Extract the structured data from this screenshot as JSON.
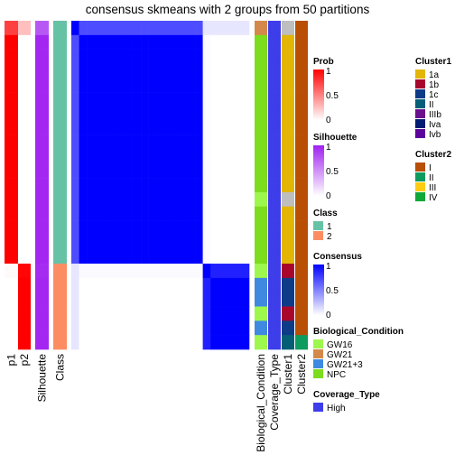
{
  "chart_data": {
    "type": "heatmap",
    "title": "consensus skmeans with 2 groups from 50 partitions",
    "column_labels": {
      "p1": "p1",
      "p2": "p2",
      "silhouette": "Silhouette",
      "class": "Class",
      "bio": "Biological_Condition",
      "coverage": "Coverage_Type",
      "cluster1": "Cluster1",
      "cluster2": "Cluster2"
    },
    "samples": {
      "p1": [
        0.75,
        1,
        1,
        1,
        1,
        1,
        1,
        1,
        1,
        1,
        1,
        1,
        1,
        1,
        1,
        1,
        1,
        0.02,
        0,
        0,
        0,
        0,
        0
      ],
      "p2": [
        0.25,
        0,
        0,
        0,
        0,
        0,
        0,
        0,
        0,
        0,
        0,
        0,
        0,
        0,
        0,
        0,
        0,
        0.98,
        1,
        1,
        1,
        1,
        1
      ],
      "silhouette": [
        0.75,
        0.97,
        0.97,
        0.97,
        0.97,
        0.97,
        0.97,
        0.97,
        0.97,
        0.97,
        0.97,
        0.97,
        0.97,
        0.97,
        0.97,
        0.97,
        0.97,
        0.95,
        0.97,
        0.97,
        0.97,
        0.97,
        0.97
      ],
      "class": [
        "1",
        "1",
        "1",
        "1",
        "1",
        "1",
        "1",
        "1",
        "1",
        "1",
        "1",
        "1",
        "1",
        "1",
        "1",
        "1",
        "1",
        "2",
        "2",
        "2",
        "2",
        "2",
        "2"
      ],
      "bio": [
        "GW21",
        "NPC",
        "NPC",
        "NPC",
        "NPC",
        "NPC",
        "NPC",
        "NPC",
        "NPC",
        "NPC",
        "NPC",
        "NPC",
        "GW16",
        "NPC",
        "NPC",
        "NPC",
        "NPC",
        "GW16",
        "GW21+3",
        "GW21+3",
        "GW16",
        "GW21+3",
        "GW16"
      ],
      "coverage": [
        "High",
        "High",
        "High",
        "High",
        "High",
        "High",
        "High",
        "High",
        "High",
        "High",
        "High",
        "High",
        "High",
        "High",
        "High",
        "High",
        "High",
        "High",
        "High",
        "High",
        "High",
        "High",
        "High"
      ],
      "cluster1": [
        null,
        "1a",
        "1a",
        "1a",
        "1a",
        "1a",
        "1a",
        "1a",
        "1a",
        "1a",
        "1a",
        "1a",
        null,
        "1a",
        "1a",
        "1a",
        "1a",
        "1b",
        "1c",
        "1c",
        "1b",
        "1c",
        "II"
      ],
      "cluster2": [
        "I",
        "I",
        "I",
        "I",
        "I",
        "I",
        "I",
        "I",
        "I",
        "I",
        "I",
        "I",
        "I",
        "I",
        "I",
        "I",
        "I",
        "I",
        "I",
        "I",
        "I",
        "I",
        "II"
      ]
    },
    "consensus_groups": {
      "top_sample_vs_class1": 0.7,
      "top_sample_vs_class2": 0.1,
      "class1_vs_class2": 0,
      "sample18_vs_class1": 0.02,
      "sample18_vs_class2": 0.87,
      "within_class": 1
    },
    "legends": {
      "prob": {
        "title": "Prob",
        "ticks": [
          "1",
          "0.5",
          "0"
        ],
        "color": "#FF0000"
      },
      "silhouette": {
        "title": "Silhouette",
        "ticks": [
          "1",
          "0.5",
          "0"
        ],
        "color": "#A020F0"
      },
      "class": {
        "title": "Class",
        "items": [
          {
            "label": "1",
            "color": "#66C2A5"
          },
          {
            "label": "2",
            "color": "#FC8D62"
          }
        ]
      },
      "consensus": {
        "title": "Consensus",
        "ticks": [
          "1",
          "0.5",
          "0"
        ],
        "color": "#0000FF"
      },
      "bio": {
        "title": "Biological_Condition",
        "items": [
          {
            "label": "GW16",
            "color": "#9EF74C"
          },
          {
            "label": "GW21",
            "color": "#D4894A"
          },
          {
            "label": "GW21+3",
            "color": "#3F8AE0"
          },
          {
            "label": "NPC",
            "color": "#7CDC1E"
          }
        ]
      },
      "coverage": {
        "title": "Coverage_Type",
        "items": [
          {
            "label": "High",
            "color": "#3D3DEA"
          }
        ]
      },
      "cluster1": {
        "title": "Cluster1",
        "items": [
          {
            "label": "1a",
            "color": "#E3B505"
          },
          {
            "label": "1b",
            "color": "#A8062B"
          },
          {
            "label": "1c",
            "color": "#0E3B87"
          },
          {
            "label": "II",
            "color": "#045E76"
          },
          {
            "label": "IIIb",
            "color": "#6A0F8E"
          },
          {
            "label": "Iva",
            "color": "#021C73"
          },
          {
            "label": "Ivb",
            "color": "#5B039C"
          }
        ]
      },
      "cluster2": {
        "title": "Cluster2",
        "items": [
          {
            "label": "I",
            "color": "#B84F04"
          },
          {
            "label": "II",
            "color": "#0E9B5E"
          },
          {
            "label": "III",
            "color": "#FFCC14"
          },
          {
            "label": "IV",
            "color": "#0FA83A"
          }
        ]
      }
    },
    "na_color": "#BEBEBE"
  }
}
